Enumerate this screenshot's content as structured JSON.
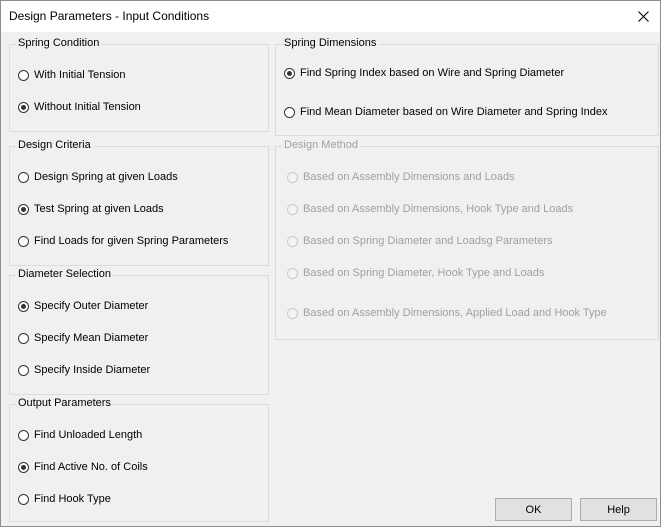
{
  "window": {
    "title": "Design Parameters - Input Conditions"
  },
  "spring_condition": {
    "label": "Spring Condition",
    "options": [
      {
        "label": "With Initial Tension",
        "checked": false
      },
      {
        "label": "Without Initial Tension",
        "checked": true
      }
    ]
  },
  "design_criteria": {
    "label": "Design Criteria",
    "options": [
      {
        "label": "Design Spring at given Loads",
        "checked": false
      },
      {
        "label": "Test Spring at given Loads",
        "checked": true
      },
      {
        "label": "Find Loads for given Spring Parameters",
        "checked": false
      }
    ]
  },
  "diameter_selection": {
    "label": "Diameter Selection",
    "options": [
      {
        "label": "Specify Outer Diameter",
        "checked": true
      },
      {
        "label": "Specify Mean Diameter",
        "checked": false
      },
      {
        "label": "Specify Inside Diameter",
        "checked": false
      }
    ]
  },
  "output_parameters": {
    "label": "Output Parameters",
    "options": [
      {
        "label": "Find Unloaded Length",
        "checked": false
      },
      {
        "label": "Find Active No. of Coils",
        "checked": true
      },
      {
        "label": "Find Hook Type",
        "checked": false
      }
    ]
  },
  "spring_dimensions": {
    "label": "Spring Dimensions",
    "options": [
      {
        "label": "Find Spring Index based on Wire and Spring Diameter",
        "checked": true
      },
      {
        "label": "Find Mean Diameter based on Wire Diameter and Spring Index",
        "checked": false
      }
    ]
  },
  "design_method": {
    "label": "Design Method",
    "enabled": false,
    "options": [
      {
        "label": "Based on Assembly Dimensions and Loads",
        "checked": false
      },
      {
        "label": "Based on Assembly Dimensions, Hook Type and Loads",
        "checked": false
      },
      {
        "label": "Based on Spring Diameter and Loadsg Parameters",
        "checked": false
      },
      {
        "label": "Based on Spring Diameter, Hook Type and Loads",
        "checked": false
      },
      {
        "label": "Based on Assembly Dimensions, Applied Load and Hook Type",
        "checked": false
      }
    ]
  },
  "buttons": {
    "ok": "OK",
    "help": "Help"
  }
}
